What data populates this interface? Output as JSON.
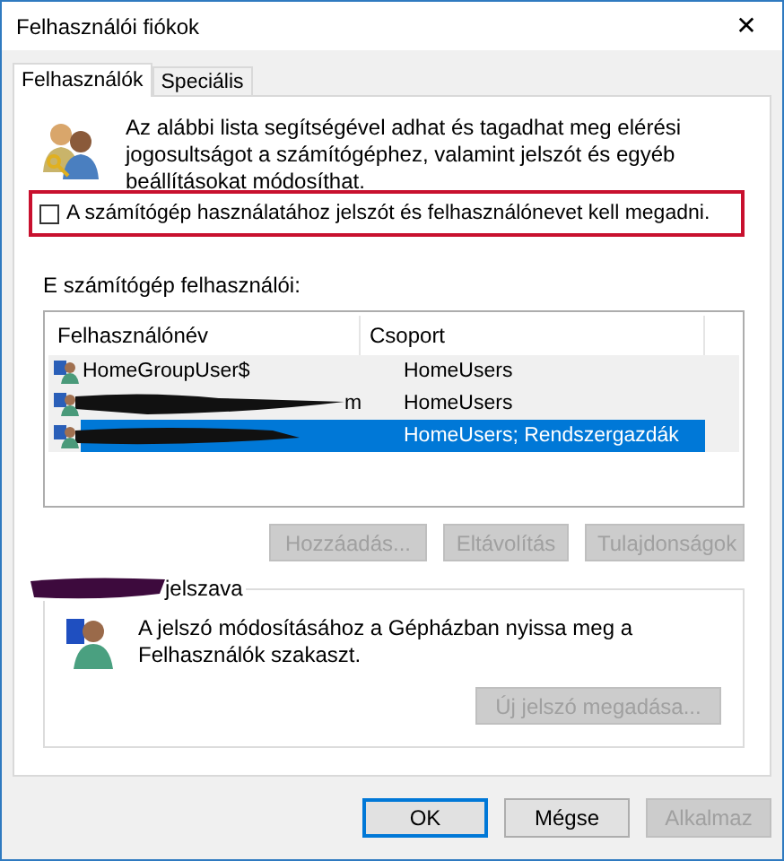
{
  "window": {
    "title": "Felhasználói fiókok",
    "close": "✕"
  },
  "tabs": [
    {
      "label": "Felhasználók",
      "selected": true
    },
    {
      "label": "Speciális",
      "selected": false
    }
  ],
  "intro": "Az alábbi lista segítségével adhat és tagadhat meg elérési jogosultságot a számítógéphez, valamint jelszót és egyéb beállításokat módosíthat.",
  "require_password": {
    "label": "A számítógép használatához jelszót és felhasználónevet kell megadni.",
    "checked": false,
    "highlighted": true
  },
  "users_label": "E számítógép felhasználói:",
  "table": {
    "columns": [
      "Felhasználónév",
      "Csoport"
    ],
    "rows": [
      {
        "name": "HomeGroupUser$",
        "group": "HomeUsers",
        "redacted": false,
        "selected": false
      },
      {
        "name": "m",
        "group": "HomeUsers",
        "redacted": true,
        "selected": false
      },
      {
        "group": "HomeUsers; Rendszergazdák",
        "redacted": true,
        "selected": true
      }
    ]
  },
  "list_buttons": [
    {
      "label": "Hozzáadás...",
      "disabled": true
    },
    {
      "label": "Eltávolítás",
      "disabled": true
    },
    {
      "label": "Tulajdonságok",
      "disabled": true
    }
  ],
  "password_group": {
    "title": "jelszava",
    "title_redacted": true,
    "text": "A jelszó módosításához a Gépházban nyissa meg a Felhasználók szakaszt.",
    "button": {
      "label": "Új jelszó megadása...",
      "disabled": true
    }
  },
  "dialog_buttons": [
    {
      "label": "OK",
      "disabled": false,
      "default": true
    },
    {
      "label": "Mégse",
      "disabled": false,
      "default": false
    },
    {
      "label": "Alkalmaz",
      "disabled": true,
      "default": false
    }
  ]
}
